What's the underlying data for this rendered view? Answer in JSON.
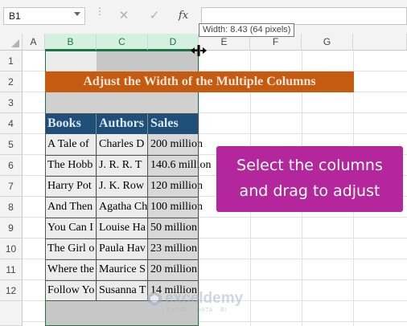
{
  "name_box": {
    "value": "B1"
  },
  "formula_bar": {
    "cancel_icon": "✕",
    "enter_icon": "✓",
    "fx_label": "fx",
    "value": ""
  },
  "tooltip": {
    "text": "Width: 8.43 (64 pixels)"
  },
  "columns": [
    "A",
    "B",
    "C",
    "D",
    "E",
    "F",
    "G"
  ],
  "selected_columns": [
    "B",
    "C",
    "D"
  ],
  "rows": [
    "1",
    "2",
    "3",
    "4",
    "5",
    "6",
    "7",
    "8",
    "9",
    "10",
    "11",
    "12"
  ],
  "sheet_title": "Adjust the Width of the Multiple Columns",
  "table": {
    "headers": [
      "Books",
      "Authors",
      "Sales"
    ],
    "rows": [
      [
        "A Tale of",
        "Charles D",
        "200 million"
      ],
      [
        "The Hobb",
        "J. R. R. T",
        "140.6 million"
      ],
      [
        "Harry Pot",
        "J. K. Row",
        "120 million"
      ],
      [
        "And Then",
        "Agatha Ch",
        "100 million"
      ],
      [
        "You Can I",
        "Louise Ha",
        "50 million"
      ],
      [
        "The Girl o",
        "Paula Hav",
        "23 million"
      ],
      [
        "Where the",
        "Maurice S",
        "20 million"
      ],
      [
        "Follow Yo",
        "Susanna T",
        "14 million"
      ]
    ]
  },
  "callout": {
    "line1": "Select the columns",
    "line2": "and drag to adjust"
  },
  "watermark": {
    "name": "exceldemy",
    "tagline": "EXCEL · DATA · BI"
  },
  "colors": {
    "selection_border": "#217346",
    "title_bg": "#c55a11",
    "table_header_bg": "#1f4e79",
    "callout_bg": "#b4279c"
  },
  "icons": [
    "dropdown-icon",
    "cancel-icon",
    "enter-icon",
    "function-icon",
    "resize-cursor-icon",
    "select-all-icon"
  ]
}
